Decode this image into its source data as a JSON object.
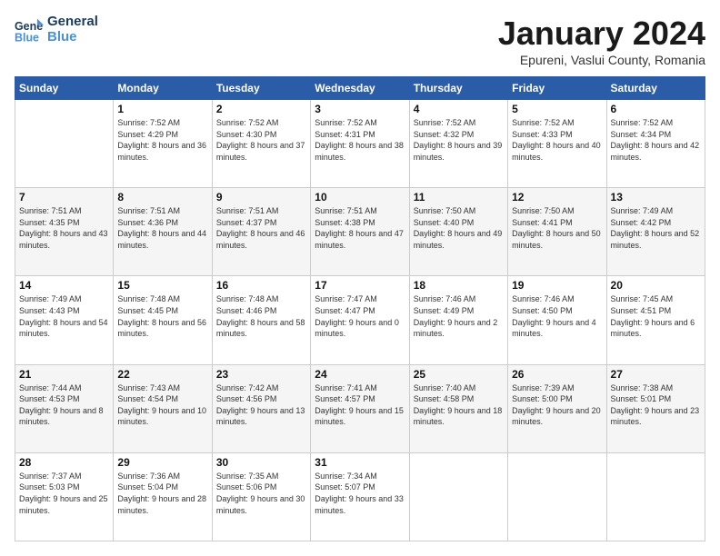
{
  "logo": {
    "line1": "General",
    "line2": "Blue"
  },
  "title": "January 2024",
  "location": "Epureni, Vaslui County, Romania",
  "weekdays": [
    "Sunday",
    "Monday",
    "Tuesday",
    "Wednesday",
    "Thursday",
    "Friday",
    "Saturday"
  ],
  "weeks": [
    [
      {
        "day": "",
        "sunrise": "",
        "sunset": "",
        "daylight": ""
      },
      {
        "day": "1",
        "sunrise": "Sunrise: 7:52 AM",
        "sunset": "Sunset: 4:29 PM",
        "daylight": "Daylight: 8 hours and 36 minutes."
      },
      {
        "day": "2",
        "sunrise": "Sunrise: 7:52 AM",
        "sunset": "Sunset: 4:30 PM",
        "daylight": "Daylight: 8 hours and 37 minutes."
      },
      {
        "day": "3",
        "sunrise": "Sunrise: 7:52 AM",
        "sunset": "Sunset: 4:31 PM",
        "daylight": "Daylight: 8 hours and 38 minutes."
      },
      {
        "day": "4",
        "sunrise": "Sunrise: 7:52 AM",
        "sunset": "Sunset: 4:32 PM",
        "daylight": "Daylight: 8 hours and 39 minutes."
      },
      {
        "day": "5",
        "sunrise": "Sunrise: 7:52 AM",
        "sunset": "Sunset: 4:33 PM",
        "daylight": "Daylight: 8 hours and 40 minutes."
      },
      {
        "day": "6",
        "sunrise": "Sunrise: 7:52 AM",
        "sunset": "Sunset: 4:34 PM",
        "daylight": "Daylight: 8 hours and 42 minutes."
      }
    ],
    [
      {
        "day": "7",
        "sunrise": "Sunrise: 7:51 AM",
        "sunset": "Sunset: 4:35 PM",
        "daylight": "Daylight: 8 hours and 43 minutes."
      },
      {
        "day": "8",
        "sunrise": "Sunrise: 7:51 AM",
        "sunset": "Sunset: 4:36 PM",
        "daylight": "Daylight: 8 hours and 44 minutes."
      },
      {
        "day": "9",
        "sunrise": "Sunrise: 7:51 AM",
        "sunset": "Sunset: 4:37 PM",
        "daylight": "Daylight: 8 hours and 46 minutes."
      },
      {
        "day": "10",
        "sunrise": "Sunrise: 7:51 AM",
        "sunset": "Sunset: 4:38 PM",
        "daylight": "Daylight: 8 hours and 47 minutes."
      },
      {
        "day": "11",
        "sunrise": "Sunrise: 7:50 AM",
        "sunset": "Sunset: 4:40 PM",
        "daylight": "Daylight: 8 hours and 49 minutes."
      },
      {
        "day": "12",
        "sunrise": "Sunrise: 7:50 AM",
        "sunset": "Sunset: 4:41 PM",
        "daylight": "Daylight: 8 hours and 50 minutes."
      },
      {
        "day": "13",
        "sunrise": "Sunrise: 7:49 AM",
        "sunset": "Sunset: 4:42 PM",
        "daylight": "Daylight: 8 hours and 52 minutes."
      }
    ],
    [
      {
        "day": "14",
        "sunrise": "Sunrise: 7:49 AM",
        "sunset": "Sunset: 4:43 PM",
        "daylight": "Daylight: 8 hours and 54 minutes."
      },
      {
        "day": "15",
        "sunrise": "Sunrise: 7:48 AM",
        "sunset": "Sunset: 4:45 PM",
        "daylight": "Daylight: 8 hours and 56 minutes."
      },
      {
        "day": "16",
        "sunrise": "Sunrise: 7:48 AM",
        "sunset": "Sunset: 4:46 PM",
        "daylight": "Daylight: 8 hours and 58 minutes."
      },
      {
        "day": "17",
        "sunrise": "Sunrise: 7:47 AM",
        "sunset": "Sunset: 4:47 PM",
        "daylight": "Daylight: 9 hours and 0 minutes."
      },
      {
        "day": "18",
        "sunrise": "Sunrise: 7:46 AM",
        "sunset": "Sunset: 4:49 PM",
        "daylight": "Daylight: 9 hours and 2 minutes."
      },
      {
        "day": "19",
        "sunrise": "Sunrise: 7:46 AM",
        "sunset": "Sunset: 4:50 PM",
        "daylight": "Daylight: 9 hours and 4 minutes."
      },
      {
        "day": "20",
        "sunrise": "Sunrise: 7:45 AM",
        "sunset": "Sunset: 4:51 PM",
        "daylight": "Daylight: 9 hours and 6 minutes."
      }
    ],
    [
      {
        "day": "21",
        "sunrise": "Sunrise: 7:44 AM",
        "sunset": "Sunset: 4:53 PM",
        "daylight": "Daylight: 9 hours and 8 minutes."
      },
      {
        "day": "22",
        "sunrise": "Sunrise: 7:43 AM",
        "sunset": "Sunset: 4:54 PM",
        "daylight": "Daylight: 9 hours and 10 minutes."
      },
      {
        "day": "23",
        "sunrise": "Sunrise: 7:42 AM",
        "sunset": "Sunset: 4:56 PM",
        "daylight": "Daylight: 9 hours and 13 minutes."
      },
      {
        "day": "24",
        "sunrise": "Sunrise: 7:41 AM",
        "sunset": "Sunset: 4:57 PM",
        "daylight": "Daylight: 9 hours and 15 minutes."
      },
      {
        "day": "25",
        "sunrise": "Sunrise: 7:40 AM",
        "sunset": "Sunset: 4:58 PM",
        "daylight": "Daylight: 9 hours and 18 minutes."
      },
      {
        "day": "26",
        "sunrise": "Sunrise: 7:39 AM",
        "sunset": "Sunset: 5:00 PM",
        "daylight": "Daylight: 9 hours and 20 minutes."
      },
      {
        "day": "27",
        "sunrise": "Sunrise: 7:38 AM",
        "sunset": "Sunset: 5:01 PM",
        "daylight": "Daylight: 9 hours and 23 minutes."
      }
    ],
    [
      {
        "day": "28",
        "sunrise": "Sunrise: 7:37 AM",
        "sunset": "Sunset: 5:03 PM",
        "daylight": "Daylight: 9 hours and 25 minutes."
      },
      {
        "day": "29",
        "sunrise": "Sunrise: 7:36 AM",
        "sunset": "Sunset: 5:04 PM",
        "daylight": "Daylight: 9 hours and 28 minutes."
      },
      {
        "day": "30",
        "sunrise": "Sunrise: 7:35 AM",
        "sunset": "Sunset: 5:06 PM",
        "daylight": "Daylight: 9 hours and 30 minutes."
      },
      {
        "day": "31",
        "sunrise": "Sunrise: 7:34 AM",
        "sunset": "Sunset: 5:07 PM",
        "daylight": "Daylight: 9 hours and 33 minutes."
      },
      {
        "day": "",
        "sunrise": "",
        "sunset": "",
        "daylight": ""
      },
      {
        "day": "",
        "sunrise": "",
        "sunset": "",
        "daylight": ""
      },
      {
        "day": "",
        "sunrise": "",
        "sunset": "",
        "daylight": ""
      }
    ]
  ]
}
